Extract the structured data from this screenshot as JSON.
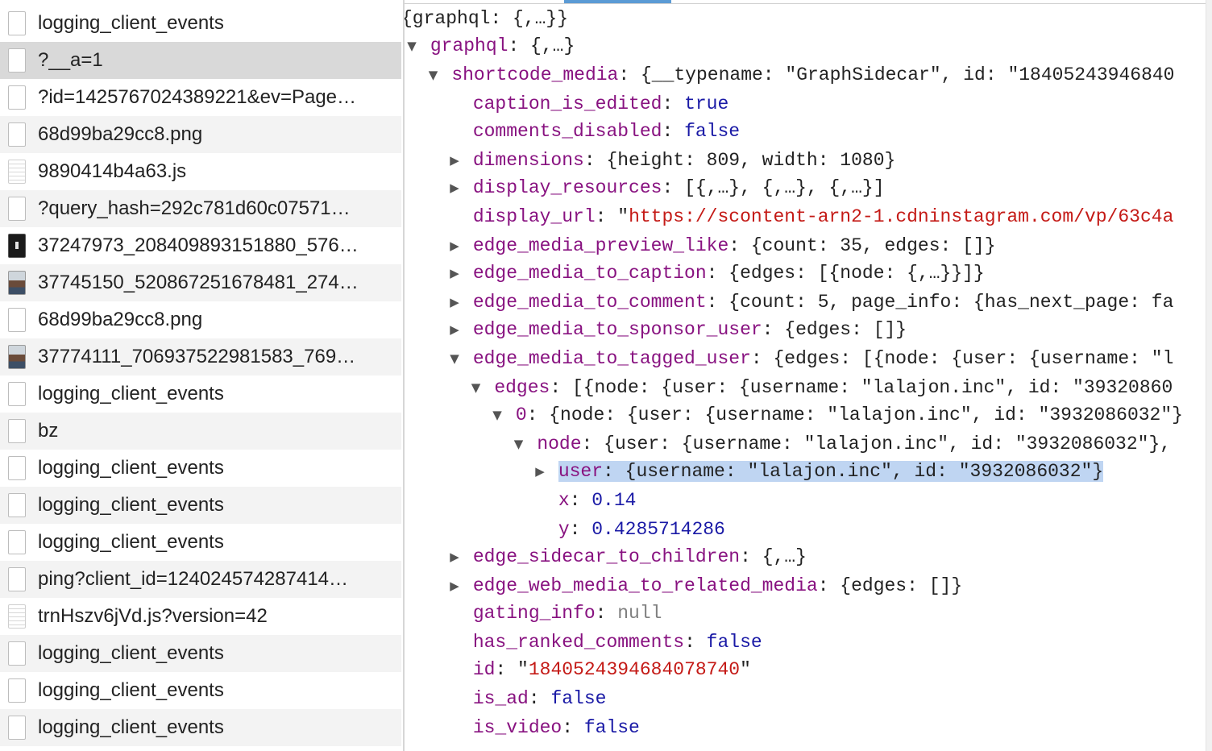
{
  "requests": [
    {
      "name": "logging_client_events",
      "type": "doc"
    },
    {
      "name": "?__a=1",
      "type": "doc",
      "selected": true
    },
    {
      "name": "?id=1425767024389221&ev=Page…",
      "type": "doc"
    },
    {
      "name": "68d99ba29cc8.png",
      "type": "doc"
    },
    {
      "name": "9890414b4a63.js",
      "type": "script"
    },
    {
      "name": "?query_hash=292c781d60c07571…",
      "type": "doc"
    },
    {
      "name": "37247973_208409893151880_576…",
      "type": "img-dark"
    },
    {
      "name": "37745150_520867251678481_274…",
      "type": "img-photo"
    },
    {
      "name": "68d99ba29cc8.png",
      "type": "doc"
    },
    {
      "name": "37774111_706937522981583_769…",
      "type": "img-photo"
    },
    {
      "name": "logging_client_events",
      "type": "doc"
    },
    {
      "name": "bz",
      "type": "doc"
    },
    {
      "name": "logging_client_events",
      "type": "doc"
    },
    {
      "name": "logging_client_events",
      "type": "doc"
    },
    {
      "name": "logging_client_events",
      "type": "doc"
    },
    {
      "name": "ping?client_id=124024574287414…",
      "type": "doc"
    },
    {
      "name": "trnHszv6jVd.js?version=42",
      "type": "script"
    },
    {
      "name": "logging_client_events",
      "type": "doc"
    },
    {
      "name": "logging_client_events",
      "type": "doc"
    },
    {
      "name": "logging_client_events",
      "type": "doc"
    }
  ],
  "preview": {
    "summary": "{graphql: {,…}}",
    "lines": [
      {
        "arrow": "down",
        "key": "graphql",
        "parts": [
          {
            "t": "p",
            "v": "{,…}"
          }
        ]
      },
      {
        "arrow": "down",
        "key": "shortcode_media",
        "parts": [
          {
            "t": "p",
            "v": "{__typename: \"GraphSidecar\", id: \"18405243946840"
          }
        ]
      },
      {
        "key": "caption_is_edited",
        "parts": [
          {
            "t": "n",
            "v": "true"
          }
        ]
      },
      {
        "key": "comments_disabled",
        "parts": [
          {
            "t": "n",
            "v": "false"
          }
        ]
      },
      {
        "arrow": "right",
        "key": "dimensions",
        "parts": [
          {
            "t": "p",
            "v": "{height: 809, width: 1080}"
          }
        ]
      },
      {
        "arrow": "right",
        "key": "display_resources",
        "parts": [
          {
            "t": "p",
            "v": "[{,…}, {,…}, {,…}]"
          }
        ]
      },
      {
        "key": "display_url",
        "parts": [
          {
            "t": "p",
            "v": "\""
          },
          {
            "t": "s",
            "v": "https://scontent-arn2-1.cdninstagram.com/vp/63c4a"
          }
        ]
      },
      {
        "arrow": "right",
        "key": "edge_media_preview_like",
        "parts": [
          {
            "t": "p",
            "v": "{count: 35, edges: []}"
          }
        ]
      },
      {
        "arrow": "right",
        "key": "edge_media_to_caption",
        "parts": [
          {
            "t": "p",
            "v": "{edges: [{node: {,…}}]}"
          }
        ]
      },
      {
        "arrow": "right",
        "key": "edge_media_to_comment",
        "parts": [
          {
            "t": "p",
            "v": "{count: 5, page_info: {has_next_page: fa"
          }
        ]
      },
      {
        "arrow": "right",
        "key": "edge_media_to_sponsor_user",
        "parts": [
          {
            "t": "p",
            "v": "{edges: []}"
          }
        ]
      },
      {
        "arrow": "down",
        "key": "edge_media_to_tagged_user",
        "parts": [
          {
            "t": "p",
            "v": "{edges: [{node: {user: {username: \"l"
          }
        ]
      },
      {
        "arrow": "down",
        "key": "edges",
        "parts": [
          {
            "t": "p",
            "v": "[{node: {user: {username: \"lalajon.inc\", id: \"39320860"
          }
        ]
      },
      {
        "arrow": "down",
        "key": "0",
        "parts": [
          {
            "t": "p",
            "v": "{node: {user: {username: \"lalajon.inc\", id: \"3932086032\"}"
          }
        ]
      },
      {
        "arrow": "down",
        "key": "node",
        "parts": [
          {
            "t": "p",
            "v": "{user: {username: \"lalajon.inc\", id: \"3932086032\"},"
          }
        ]
      },
      {
        "arrow": "right",
        "key": "user",
        "highlight": true,
        "parts": [
          {
            "t": "p",
            "v": "{username: \"lalajon.inc\", id: \"3932086032\"}"
          }
        ]
      },
      {
        "key": "x",
        "parts": [
          {
            "t": "n",
            "v": "0.14"
          }
        ]
      },
      {
        "key": "y",
        "parts": [
          {
            "t": "n",
            "v": "0.4285714286"
          }
        ]
      },
      {
        "arrow": "right",
        "key": "edge_sidecar_to_children",
        "parts": [
          {
            "t": "p",
            "v": "{,…}"
          }
        ]
      },
      {
        "arrow": "right",
        "key": "edge_web_media_to_related_media",
        "parts": [
          {
            "t": "p",
            "v": "{edges: []}"
          }
        ]
      },
      {
        "key": "gating_info",
        "parts": [
          {
            "t": "nul",
            "v": "null"
          }
        ]
      },
      {
        "key": "has_ranked_comments",
        "parts": [
          {
            "t": "n",
            "v": "false"
          }
        ]
      },
      {
        "key": "id",
        "parts": [
          {
            "t": "p",
            "v": "\""
          },
          {
            "t": "s",
            "v": "1840524394684078740"
          },
          {
            "t": "p",
            "v": "\""
          }
        ]
      },
      {
        "key": "is_ad",
        "parts": [
          {
            "t": "n",
            "v": "false"
          }
        ]
      },
      {
        "key": "is_video",
        "parts": [
          {
            "t": "n",
            "v": "false"
          }
        ]
      }
    ]
  }
}
